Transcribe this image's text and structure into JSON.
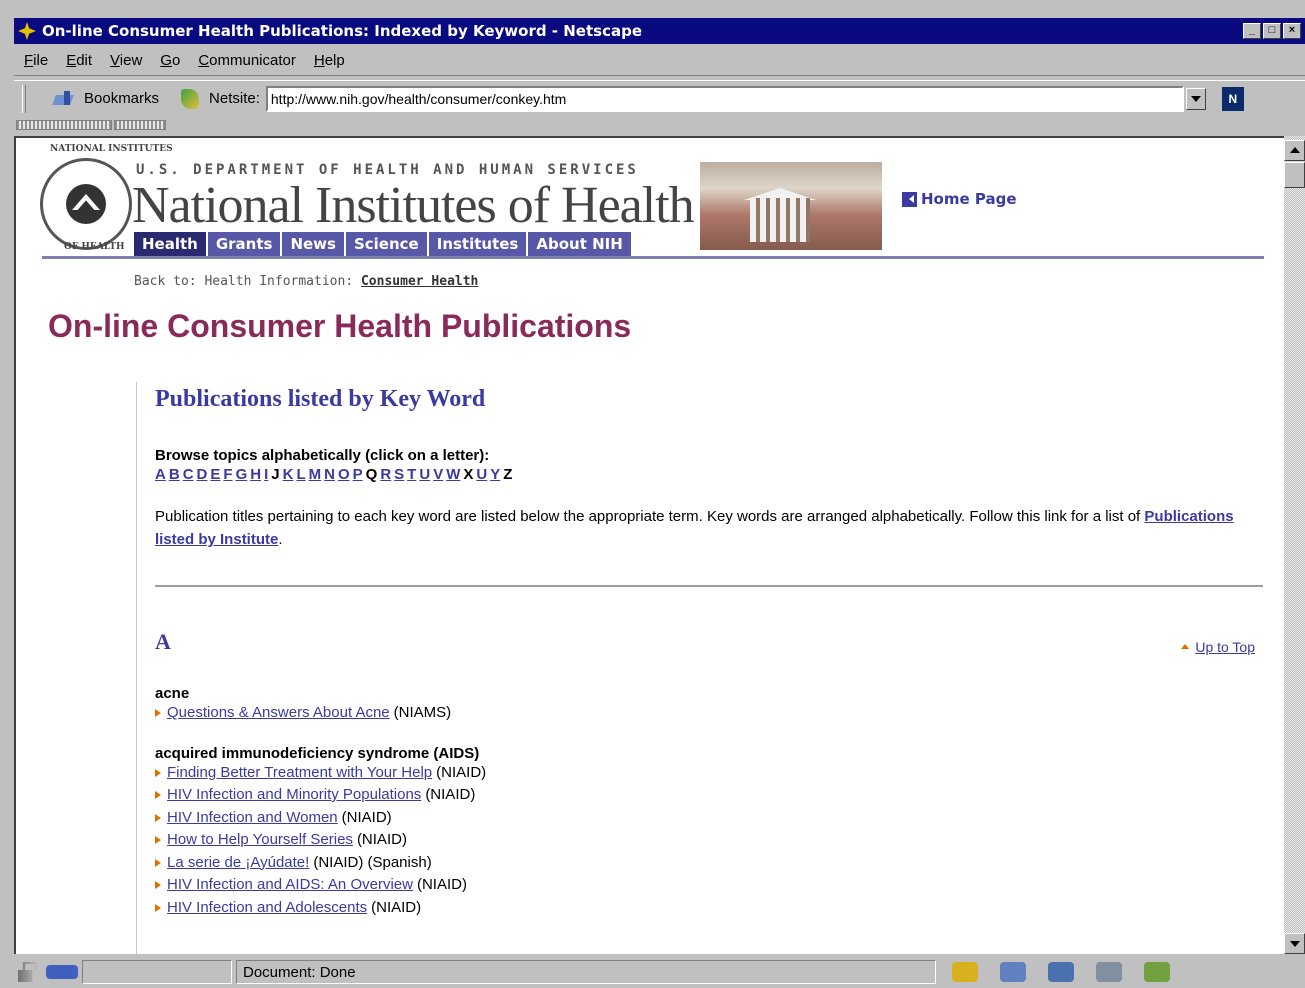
{
  "window": {
    "title": "On-line Consumer Health Publications: Indexed by Keyword - Netscape",
    "buttons": [
      "_",
      "□",
      "×"
    ]
  },
  "menu": [
    "File",
    "Edit",
    "View",
    "Go",
    "Communicator",
    "Help"
  ],
  "toolbar": {
    "bookmarks_label": "Bookmarks",
    "netsite_label": "Netsite:",
    "url": "http://www.nih.gov/health/consumer/conkey.htm",
    "logo": "N"
  },
  "header": {
    "seal_top": "NATIONAL INSTITUTES",
    "seal_bottom": "OF HEALTH",
    "department": "U.S. DEPARTMENT OF HEALTH AND HUMAN SERVICES",
    "name": "National Institutes of Health",
    "home_link": "Home Page",
    "tabs": [
      "Health",
      "Grants",
      "News",
      "Science",
      "Institutes",
      "About NIH"
    ],
    "active_tab": "Health"
  },
  "breadcrumb": {
    "prefix": "Back to: Health Information:",
    "link": "Consumer Health"
  },
  "page_title": "On-line Consumer Health Publications",
  "section": {
    "heading": "Publications listed by Key Word",
    "browse_label": "Browse topics alphabetically (click on a letter):",
    "letters": [
      {
        "l": "A",
        "link": true
      },
      {
        "l": "B",
        "link": true
      },
      {
        "l": "C",
        "link": true
      },
      {
        "l": "D",
        "link": true
      },
      {
        "l": "E",
        "link": true
      },
      {
        "l": "F",
        "link": true
      },
      {
        "l": "G",
        "link": true
      },
      {
        "l": "H",
        "link": true
      },
      {
        "l": "I",
        "link": true
      },
      {
        "l": "J",
        "link": false
      },
      {
        "l": "K",
        "link": true
      },
      {
        "l": "L",
        "link": true
      },
      {
        "l": "M",
        "link": true
      },
      {
        "l": "N",
        "link": true
      },
      {
        "l": "O",
        "link": true
      },
      {
        "l": "P",
        "link": true
      },
      {
        "l": "Q",
        "link": false
      },
      {
        "l": "R",
        "link": true
      },
      {
        "l": "S",
        "link": true
      },
      {
        "l": "T",
        "link": true
      },
      {
        "l": "U",
        "link": true
      },
      {
        "l": "V",
        "link": true
      },
      {
        "l": "W",
        "link": true
      },
      {
        "l": "X",
        "link": false
      },
      {
        "l": "U",
        "link": true
      },
      {
        "l": "Y",
        "link": true
      },
      {
        "l": "Z",
        "link": false
      }
    ],
    "intro_text": "Publication titles pertaining to each key word are listed below the appropriate term. Key words are arranged alphabetically. Follow this link for a list of",
    "intro_link": "Publications listed by Institute",
    "intro_end": "."
  },
  "letter_section": {
    "letter": "A",
    "up_to_top": "Up to Top",
    "topics": [
      {
        "name": "acne",
        "pubs": [
          {
            "title": "Questions & Answers About Acne",
            "source": "(NIAMS)"
          }
        ]
      },
      {
        "name": "acquired immunodeficiency syndrome (AIDS)",
        "pubs": [
          {
            "title": "Finding Better Treatment with Your Help",
            "source": "(NIAID)"
          },
          {
            "title": "HIV Infection and Minority Populations",
            "source": "(NIAID)"
          },
          {
            "title": "HIV Infection and Women",
            "source": "(NIAID)"
          },
          {
            "title": "How to Help Yourself Series",
            "source": "(NIAID)"
          },
          {
            "title": "La serie de ¡Ayúdate!",
            "source": "(NIAID) (Spanish)"
          },
          {
            "title": "HIV Infection and AIDS: An Overview",
            "source": "(NIAID)"
          },
          {
            "title": "HIV Infection and Adolescents",
            "source": "(NIAID)"
          }
        ]
      }
    ]
  },
  "status": {
    "text": "Document: Done"
  }
}
